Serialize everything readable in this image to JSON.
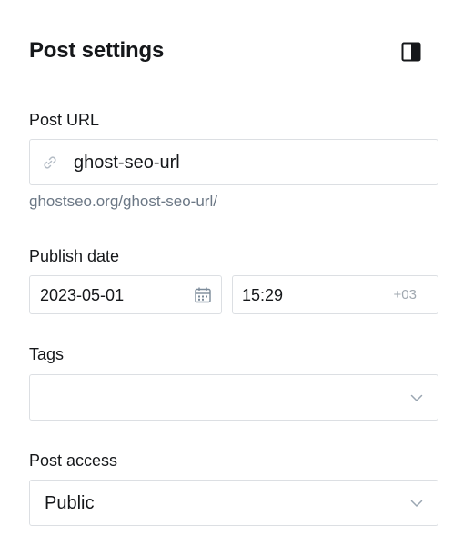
{
  "header": {
    "title": "Post settings",
    "toggle_icon": "sidebar-toggle-icon"
  },
  "post_url": {
    "label": "Post URL",
    "value": "ghost-seo-url",
    "icon": "link-icon",
    "full_url": "ghostseo.org/ghost-seo-url/"
  },
  "publish_date": {
    "label": "Publish date",
    "date": "2023-05-01",
    "date_icon": "calendar-icon",
    "time": "15:29",
    "timezone": "+03"
  },
  "tags": {
    "label": "Tags",
    "value": "",
    "icon": "chevron-down-icon"
  },
  "post_access": {
    "label": "Post access",
    "selected": "Public",
    "icon": "chevron-down-icon"
  },
  "colors": {
    "text": "#15171a",
    "muted": "#6b7785",
    "border": "#dcdfe3",
    "icon": "#7c8b9a"
  }
}
